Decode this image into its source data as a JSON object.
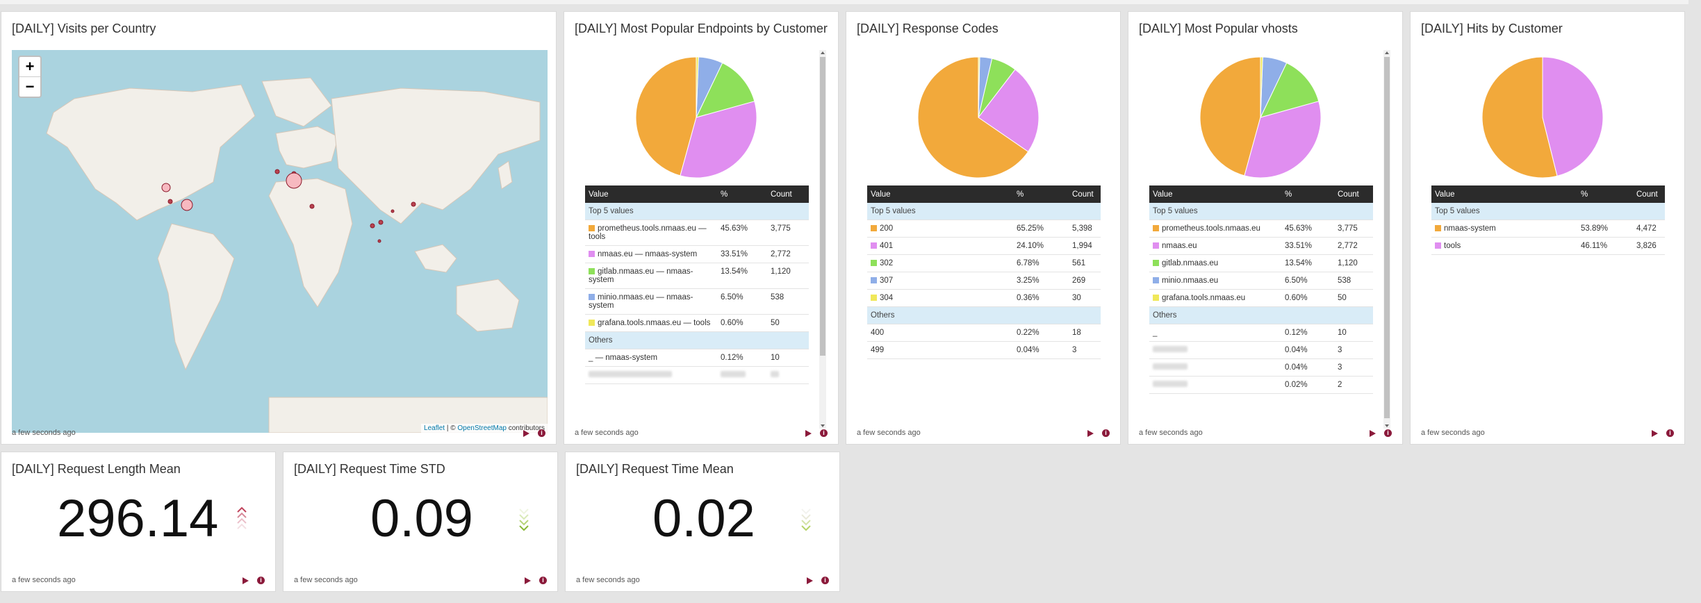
{
  "timestamp": "a few seconds ago",
  "colors": {
    "c1": "#f2a93b",
    "c2": "#e08ef0",
    "c3": "#8ee05a",
    "c4": "#8faee8",
    "c5": "#f0e85a"
  },
  "table_headers": {
    "value": "Value",
    "pct": "%",
    "count": "Count"
  },
  "group_labels": {
    "top": "Top 5 values",
    "others": "Others"
  },
  "visits": {
    "title": "[DAILY] Visits per Country",
    "zoom_in": "+",
    "zoom_out": "−",
    "attribution": {
      "leaflet": "Leaflet",
      "sep": " | © ",
      "osm": "OpenStreetMap",
      "contrib": " contributors"
    }
  },
  "endpoints": {
    "title": "[DAILY] Most Popular Endpoints by Customer",
    "rows": [
      {
        "value": "prometheus.tools.nmaas.eu — tools",
        "pct": "45.63%",
        "count": "3,775"
      },
      {
        "value": "nmaas.eu — nmaas-system",
        "pct": "33.51%",
        "count": "2,772"
      },
      {
        "value": "gitlab.nmaas.eu — nmaas-system",
        "pct": "13.54%",
        "count": "1,120"
      },
      {
        "value": "minio.nmaas.eu — nmaas-system",
        "pct": "6.50%",
        "count": "538"
      },
      {
        "value": "grafana.tools.nmaas.eu — tools",
        "pct": "0.60%",
        "count": "50"
      }
    ],
    "others": [
      {
        "value": "_ — nmaas-system",
        "pct": "0.12%",
        "count": "10"
      }
    ]
  },
  "response": {
    "title": "[DAILY] Response Codes",
    "rows": [
      {
        "value": "200",
        "pct": "65.25%",
        "count": "5,398"
      },
      {
        "value": "401",
        "pct": "24.10%",
        "count": "1,994"
      },
      {
        "value": "302",
        "pct": "6.78%",
        "count": "561"
      },
      {
        "value": "307",
        "pct": "3.25%",
        "count": "269"
      },
      {
        "value": "304",
        "pct": "0.36%",
        "count": "30"
      }
    ],
    "others": [
      {
        "value": "400",
        "pct": "0.22%",
        "count": "18"
      },
      {
        "value": "499",
        "pct": "0.04%",
        "count": "3"
      }
    ]
  },
  "vhosts": {
    "title": "[DAILY] Most Popular vhosts",
    "rows": [
      {
        "value": "prometheus.tools.nmaas.eu",
        "pct": "45.63%",
        "count": "3,775"
      },
      {
        "value": "nmaas.eu",
        "pct": "33.51%",
        "count": "2,772"
      },
      {
        "value": "gitlab.nmaas.eu",
        "pct": "13.54%",
        "count": "1,120"
      },
      {
        "value": "minio.nmaas.eu",
        "pct": "6.50%",
        "count": "538"
      },
      {
        "value": "grafana.tools.nmaas.eu",
        "pct": "0.60%",
        "count": "50"
      }
    ],
    "others": [
      {
        "value": "_",
        "pct": "0.12%",
        "count": "10"
      },
      {
        "value": "",
        "pct": "0.04%",
        "count": "3"
      },
      {
        "value": "",
        "pct": "0.04%",
        "count": "3"
      },
      {
        "value": "",
        "pct": "0.02%",
        "count": "2"
      }
    ]
  },
  "customers": {
    "title": "[DAILY] Hits by Customer",
    "rows": [
      {
        "value": "nmaas-system",
        "pct": "53.89%",
        "count": "4,472"
      },
      {
        "value": "tools",
        "pct": "46.11%",
        "count": "3,826"
      }
    ]
  },
  "metrics": [
    {
      "title": "[DAILY] Request Length Mean",
      "value": "296.14",
      "trend": "up"
    },
    {
      "title": "[DAILY] Request Time STD",
      "value": "0.09",
      "trend": "down"
    },
    {
      "title": "[DAILY] Request Time Mean",
      "value": "0.02",
      "trend": "down"
    }
  ],
  "chart_data": [
    {
      "type": "pie",
      "title": "[DAILY] Most Popular Endpoints by Customer",
      "categories": [
        "prometheus.tools.nmaas.eu — tools",
        "nmaas.eu — nmaas-system",
        "gitlab.nmaas.eu — nmaas-system",
        "minio.nmaas.eu — nmaas-system",
        "grafana.tools.nmaas.eu — tools"
      ],
      "values": [
        45.63,
        33.51,
        13.54,
        6.5,
        0.6
      ]
    },
    {
      "type": "pie",
      "title": "[DAILY] Response Codes",
      "categories": [
        "200",
        "401",
        "302",
        "307",
        "304"
      ],
      "values": [
        65.25,
        24.1,
        6.78,
        3.25,
        0.36
      ]
    },
    {
      "type": "pie",
      "title": "[DAILY] Most Popular vhosts",
      "categories": [
        "prometheus.tools.nmaas.eu",
        "nmaas.eu",
        "gitlab.nmaas.eu",
        "minio.nmaas.eu",
        "grafana.tools.nmaas.eu"
      ],
      "values": [
        45.63,
        33.51,
        13.54,
        6.5,
        0.6
      ]
    },
    {
      "type": "pie",
      "title": "[DAILY] Hits by Customer",
      "categories": [
        "nmaas-system",
        "tools"
      ],
      "values": [
        53.89,
        46.11
      ]
    }
  ]
}
